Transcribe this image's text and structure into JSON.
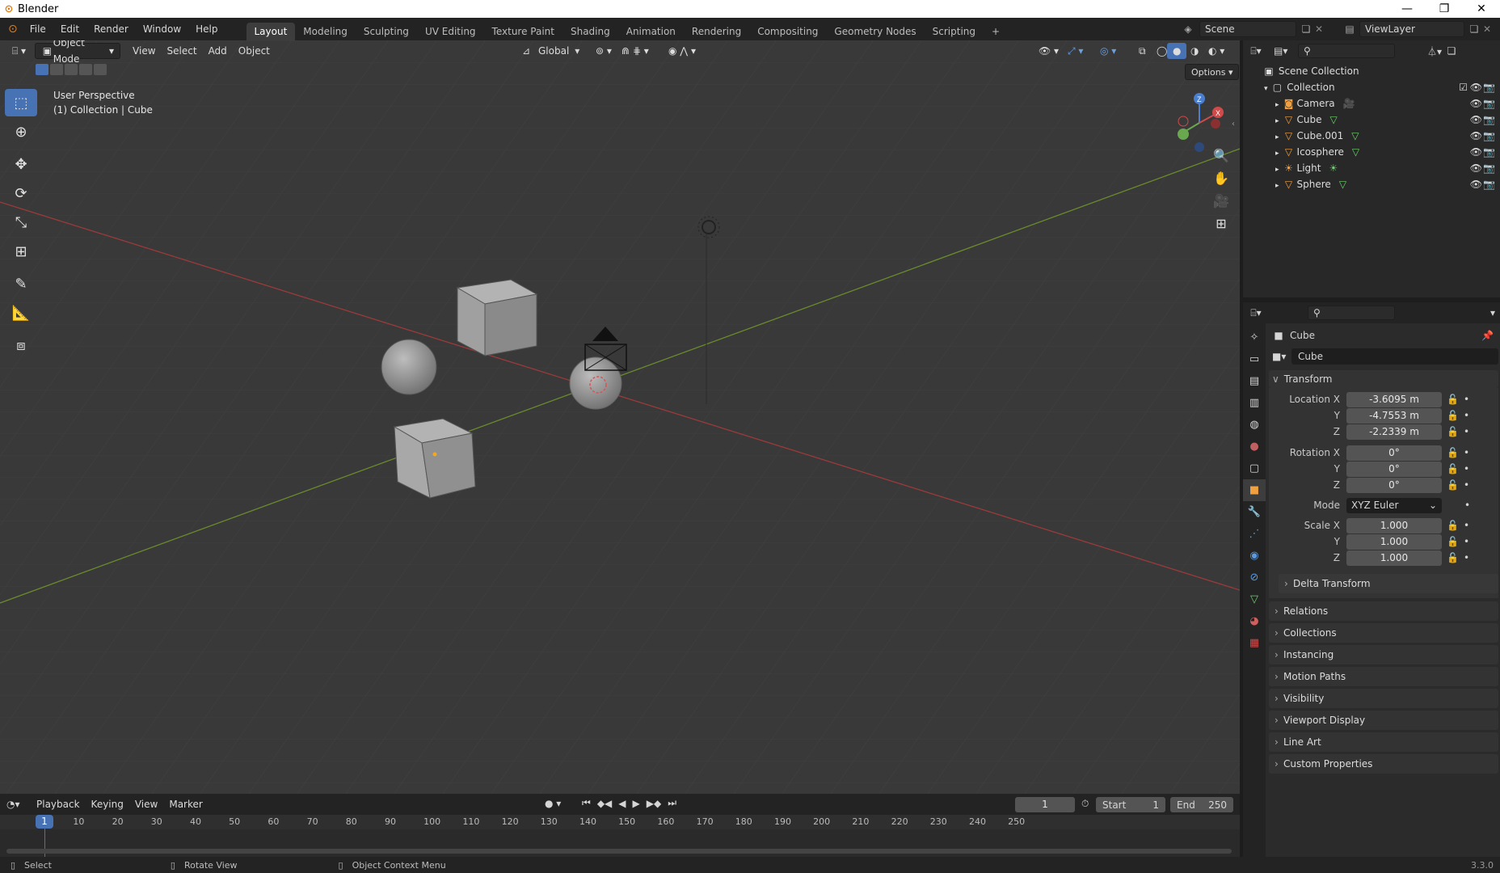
{
  "window": {
    "title": "Blender"
  },
  "menu": [
    "File",
    "Edit",
    "Render",
    "Window",
    "Help"
  ],
  "workspaces": [
    "Layout",
    "Modeling",
    "Sculpting",
    "UV Editing",
    "Texture Paint",
    "Shading",
    "Animation",
    "Rendering",
    "Compositing",
    "Geometry Nodes",
    "Scripting",
    "+"
  ],
  "scene": {
    "name": "Scene",
    "view_layer": "ViewLayer"
  },
  "viewport": {
    "mode": "Object Mode",
    "menus": [
      "View",
      "Select",
      "Add",
      "Object"
    ],
    "orientation": "Global",
    "options": "Options",
    "perspective": "User Perspective",
    "context": "(1) Collection | Cube",
    "gizmo": {
      "x": "X",
      "y": "Y",
      "z": "Z"
    }
  },
  "outliner": {
    "root": "Scene Collection",
    "collection": "Collection",
    "items": [
      {
        "name": "Camera",
        "icon": "camera-icon"
      },
      {
        "name": "Cube",
        "icon": "mesh-icon"
      },
      {
        "name": "Cube.001",
        "icon": "mesh-icon"
      },
      {
        "name": "Icosphere",
        "icon": "mesh-icon"
      },
      {
        "name": "Light",
        "icon": "light-icon"
      },
      {
        "name": "Sphere",
        "icon": "mesh-icon"
      }
    ]
  },
  "properties": {
    "object_name": "Cube",
    "object_field": "Cube",
    "transform_title": "Transform",
    "location": {
      "label": "Location X",
      "x": "-3.6095 m",
      "y": "-4.7553 m",
      "z": "-2.2339 m"
    },
    "rotation": {
      "label": "Rotation X",
      "x": "0°",
      "y": "0°",
      "z": "0°"
    },
    "mode": {
      "label": "Mode",
      "value": "XYZ Euler"
    },
    "scale": {
      "label": "Scale X",
      "x": "1.000",
      "y": "1.000",
      "z": "1.000"
    },
    "axis_labels": {
      "y": "Y",
      "z": "Z"
    },
    "delta": "Delta Transform",
    "panels": [
      "Relations",
      "Collections",
      "Instancing",
      "Motion Paths",
      "Visibility",
      "Viewport Display",
      "Line Art",
      "Custom Properties"
    ]
  },
  "timeline": {
    "menus": [
      "Playback",
      "Keying",
      "View",
      "Marker"
    ],
    "current_frame": "1",
    "start_label": "Start",
    "start": "1",
    "end_label": "End",
    "end": "250",
    "ticks": [
      "10",
      "20",
      "30",
      "40",
      "50",
      "60",
      "70",
      "80",
      "90",
      "100",
      "110",
      "120",
      "130",
      "140",
      "150",
      "160",
      "170",
      "180",
      "190",
      "200",
      "210",
      "220",
      "230",
      "240",
      "250"
    ],
    "playhead": "1"
  },
  "status": {
    "select": "Select",
    "rotate": "Rotate View",
    "context": "Object Context Menu",
    "version": "3.3.0"
  }
}
